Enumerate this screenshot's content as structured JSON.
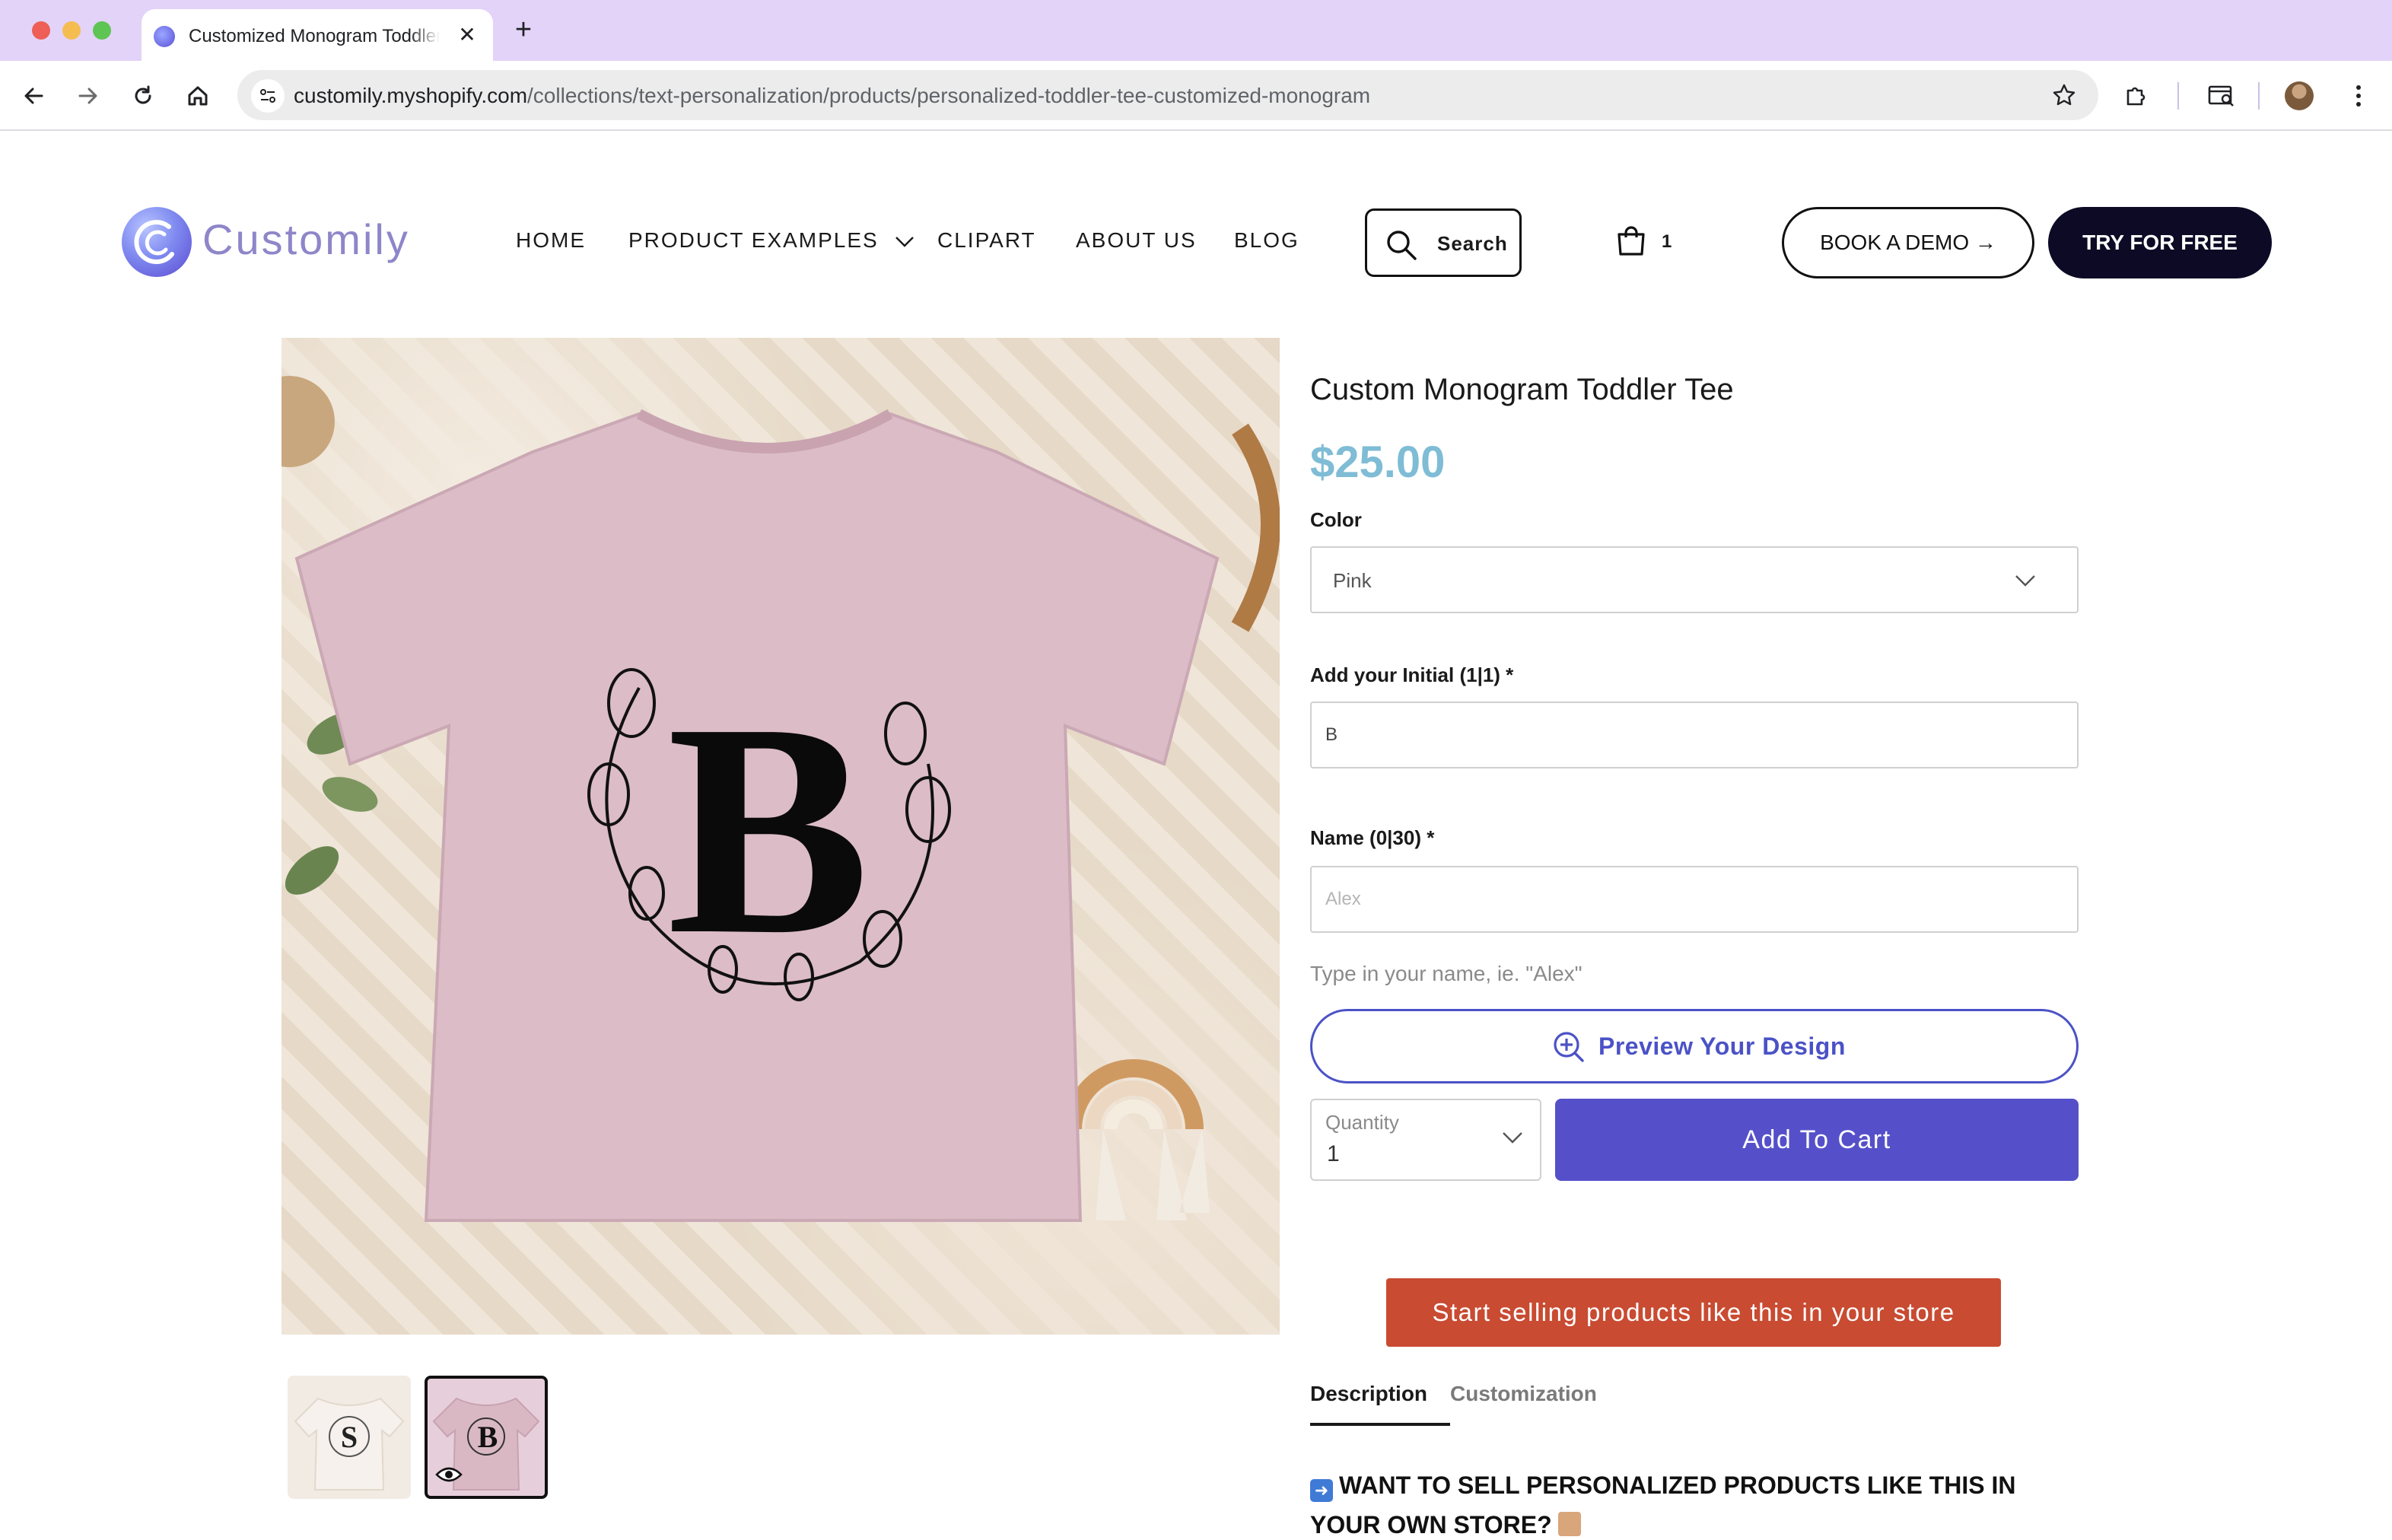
{
  "browser": {
    "tab_title": "Customized Monogram Toddler Tee",
    "url_host": "customily.myshopify.com",
    "url_path": "/collections/text-personalization/products/personalized-toddler-tee-customized-monogram"
  },
  "header": {
    "logo_text": "Customily",
    "nav": [
      {
        "label": "HOME"
      },
      {
        "label": "PRODUCT EXAMPLES"
      },
      {
        "label": "CLIPART"
      },
      {
        "label": "ABOUT US"
      },
      {
        "label": "BLOG"
      }
    ],
    "search_label": "Search",
    "cart_count": "1",
    "demo_label": "BOOK A DEMO →",
    "try_label": "TRY FOR FREE"
  },
  "product": {
    "image_letter": "B",
    "thumbs": [
      {
        "letter": "S"
      },
      {
        "letter": "B"
      }
    ],
    "title": "Custom Monogram Toddler Tee",
    "price": "$25.00",
    "color_label": "Color",
    "color_value": "Pink",
    "initial_label": "Add your Initial (1|1) *",
    "initial_value": "B",
    "name_label": "Name (0|30) *",
    "name_placeholder": "Alex",
    "name_help": "Type in your name, ie. \"Alex\"",
    "preview_label": "Preview Your Design",
    "quantity_label": "Quantity",
    "quantity_value": "1",
    "add_to_cart_label": "Add To Cart",
    "sell_label": "Start selling products like this in your store"
  },
  "tabs": [
    {
      "label": "Description",
      "active": true
    },
    {
      "label": "Customization",
      "active": false
    }
  ],
  "description": {
    "heading": "WANT TO SELL PERSONALIZED PRODUCTS LIKE THIS IN YOUR OWN STORE?"
  },
  "colors": {
    "accent": "#5550c9",
    "price": "#7fbcd5",
    "sell_button": "#c84b32",
    "tabbar": "#e3d3f8"
  }
}
